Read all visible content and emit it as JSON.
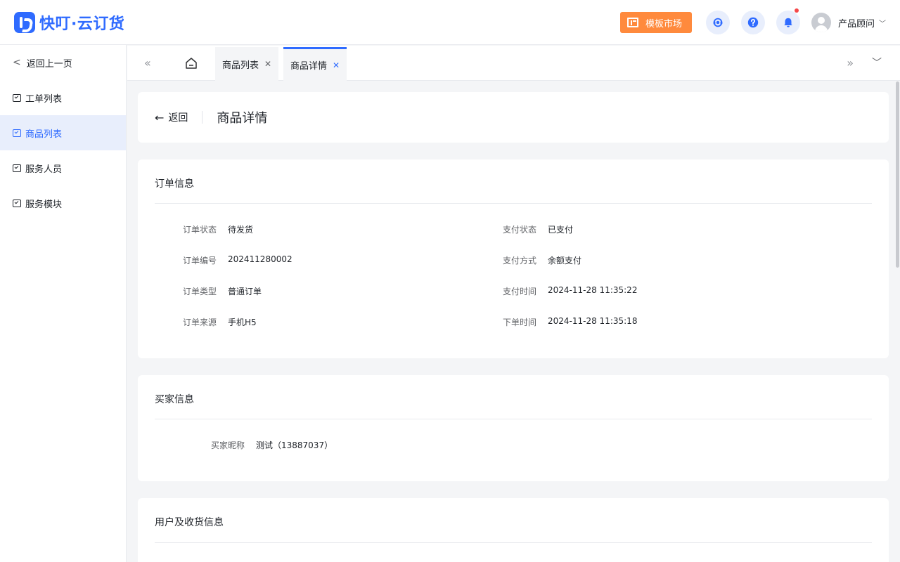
{
  "header": {
    "logo_text": "快叮·云订货",
    "market_label": "模板市场",
    "user_name": "产品顾问",
    "icons": [
      "service-icon",
      "help-icon",
      "bell-icon"
    ],
    "accent": "#2f6bff",
    "market_color": "#ff8a3d"
  },
  "sidebar": {
    "back_label": "返回上一页",
    "items": [
      {
        "label": "工单列表",
        "active": false
      },
      {
        "label": "商品列表",
        "active": true
      },
      {
        "label": "服务人员",
        "active": false
      },
      {
        "label": "服务模块",
        "active": false
      }
    ]
  },
  "tabs": [
    {
      "label": "商品列表",
      "active": false
    },
    {
      "label": "商品详情",
      "active": true
    }
  ],
  "page": {
    "back_label": "返回",
    "title": "商品详情"
  },
  "order_info": {
    "title": "订单信息",
    "left": [
      {
        "key": "订单状态",
        "value": "待发货"
      },
      {
        "key": "订单编号",
        "value": "202411280002"
      },
      {
        "key": "订单类型",
        "value": "普通订单"
      },
      {
        "key": "订单来源",
        "value": "手机H5"
      }
    ],
    "right": [
      {
        "key": "支付状态",
        "value": "已支付"
      },
      {
        "key": "支付方式",
        "value": "余额支付"
      },
      {
        "key": "支付时间",
        "value": "2024-11-28 11:35:22"
      },
      {
        "key": "下单时间",
        "value": "2024-11-28 11:35:18"
      }
    ]
  },
  "buyer_info": {
    "title": "买家信息",
    "nickname_label": "买家昵称",
    "nickname_value": "测试（13887037）"
  },
  "user_receive_info": {
    "title": "用户及收货信息"
  }
}
